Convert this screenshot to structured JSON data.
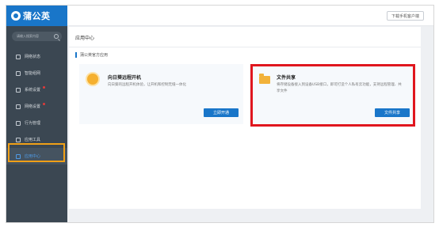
{
  "app": {
    "logo_text": "蒲公英"
  },
  "topbar": {
    "download_label": "下载手机客户端"
  },
  "sidebar": {
    "search_placeholder": "请输入搜索内容",
    "items": [
      {
        "label": "网络状态",
        "icon": "network-status-icon",
        "badge": false
      },
      {
        "label": "智能组网",
        "icon": "smart-network-icon",
        "badge": false
      },
      {
        "label": "系统设置",
        "icon": "system-settings-icon",
        "badge": true
      },
      {
        "label": "网络设置",
        "icon": "network-settings-icon",
        "badge": true
      },
      {
        "label": "行为管理",
        "icon": "behavior-management-icon",
        "badge": false
      },
      {
        "label": "应用工具",
        "icon": "app-tools-icon",
        "badge": false
      },
      {
        "label": "应用中心",
        "icon": "app-center-icon",
        "badge": false,
        "active": true
      }
    ]
  },
  "content": {
    "title": "应用中心",
    "section_title": "蒲公英官方应用",
    "cards": [
      {
        "title": "向日葵远程开机",
        "description": "向日葵的远程开机体验，让开机和控制无缝一体化",
        "button": "立即开通",
        "icon": "sunflower-icon"
      },
      {
        "title": "文件共享",
        "description": "将存储设备接入到设备USB接口，即可打造个人私有云功能，支持远程管理、共享文件",
        "button": "文件共享",
        "icon": "folder-icon"
      }
    ]
  },
  "colors": {
    "sidebar_bg": "#3b4752",
    "brand": "#1976c9",
    "highlight_red": "#e0161e",
    "highlight_orange": "#f0a017"
  }
}
